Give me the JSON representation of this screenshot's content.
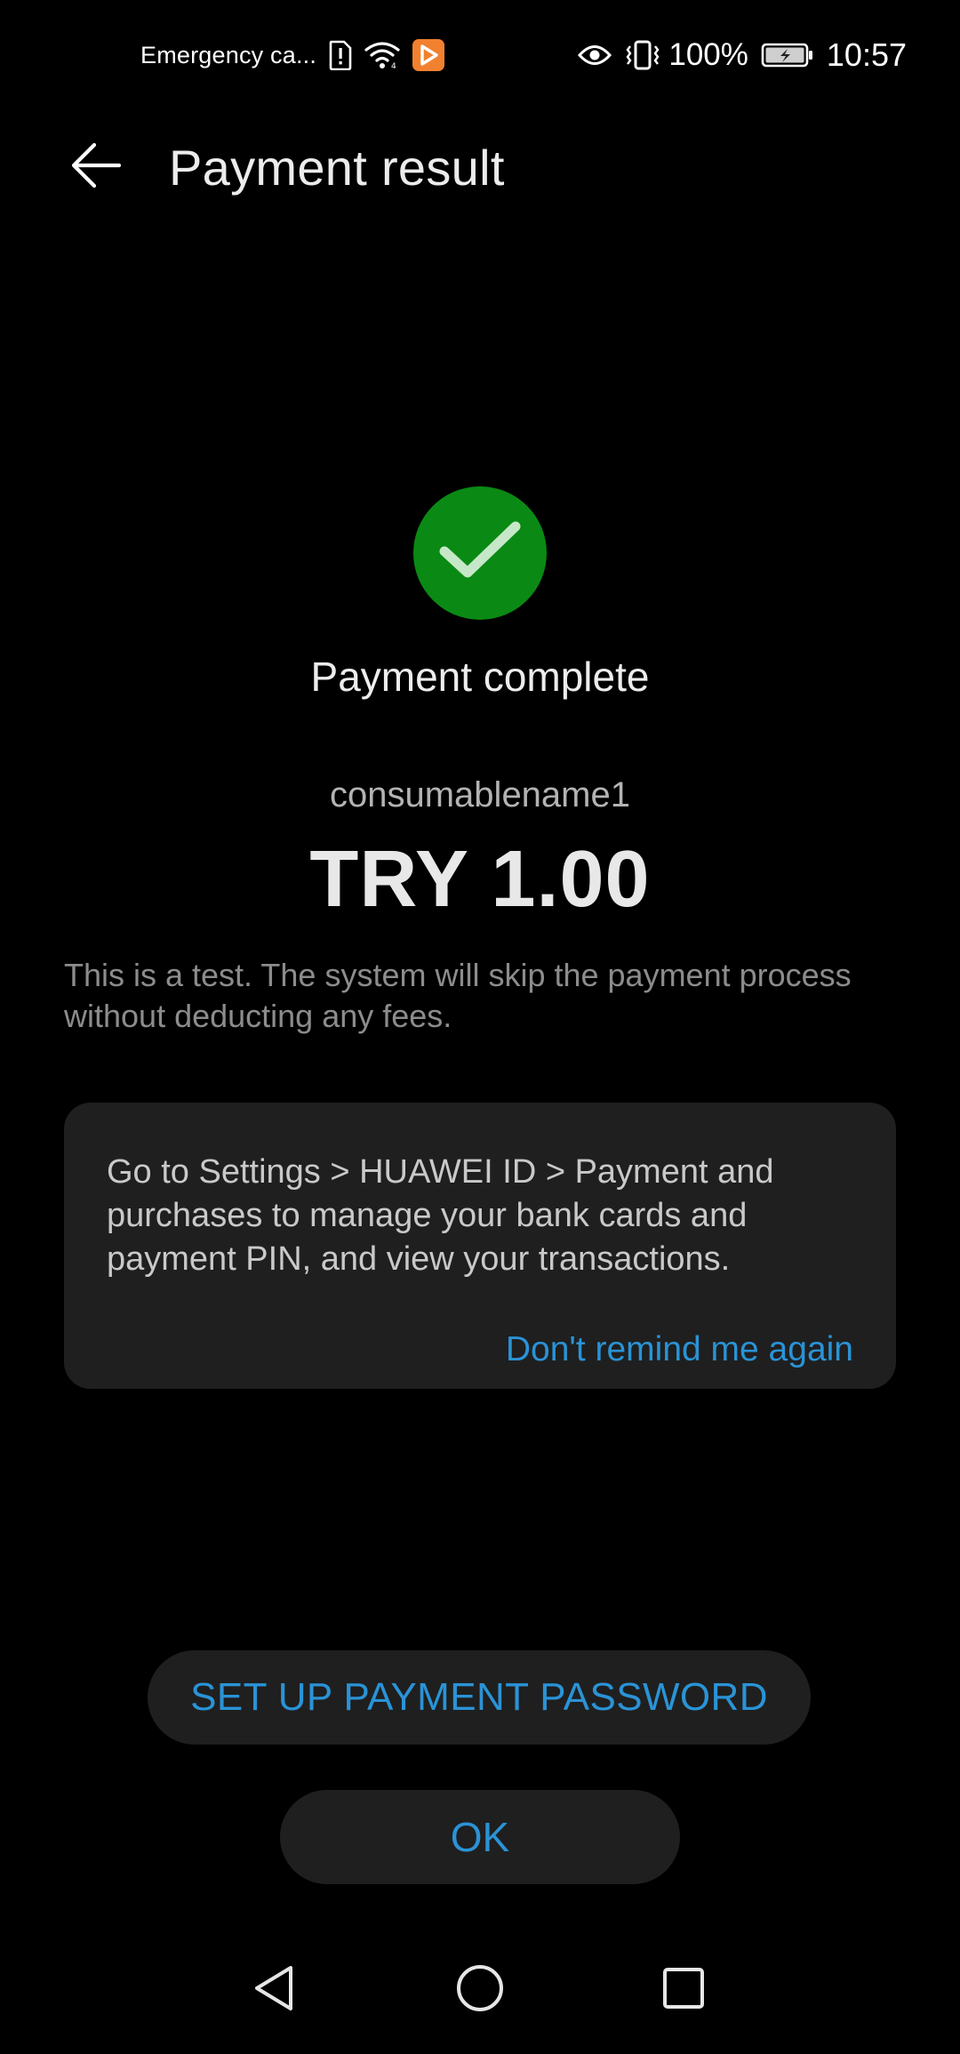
{
  "status_bar": {
    "carrier": "Emergency ca...",
    "battery_percent": "100%",
    "time": "10:57",
    "icons": [
      "sim-alert-icon",
      "wifi-icon",
      "app-notification-icon",
      "eye-comfort-icon",
      "vibrate-icon",
      "battery-charging-icon"
    ]
  },
  "app_bar": {
    "title": "Payment result",
    "back_icon": "arrow-left-icon"
  },
  "result": {
    "status_icon": "check-icon",
    "status_text": "Payment complete",
    "product_name": "consumablename1",
    "amount": "TRY 1.00",
    "test_note": "This is a test. The system will skip the payment process without deducting any fees."
  },
  "info_card": {
    "text": "Go to Settings > HUAWEI ID > Payment and purchases to manage your bank cards and payment PIN, and view your transactions.",
    "link": "Don't remind me again"
  },
  "actions": {
    "setup_label": "SET UP PAYMENT PASSWORD",
    "ok_label": "OK"
  },
  "nav_bar": {
    "back_icon": "nav-back-icon",
    "home_icon": "nav-home-icon",
    "recent_icon": "nav-recent-icon"
  },
  "colors": {
    "background": "#000000",
    "accent": "#2a93d6",
    "success": "#0a8a14",
    "card": "#1f1f1f"
  }
}
